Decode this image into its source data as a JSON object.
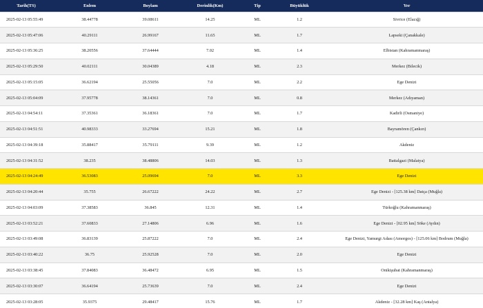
{
  "table": {
    "headers": {
      "date": "Tarih(TS)",
      "lat": "Enlem",
      "lon": "Boylam",
      "depth": "Derinlik(Km)",
      "type": "Tip",
      "magnitude": "Büyüklük",
      "location": "Yer"
    },
    "highlight_color": "#ffe400",
    "header_color": "#152b5c",
    "rows": [
      {
        "date": "2025-02-13 05:55:49",
        "lat": "38.44778",
        "lon": "39.08611",
        "depth": "14.25",
        "type": "ML",
        "magnitude": "1.2",
        "location": "Sivrice (Elazığ)"
      },
      {
        "date": "2025-02-13 05:47:06",
        "lat": "40.29111",
        "lon": "26.99167",
        "depth": "11.65",
        "type": "ML",
        "magnitude": "1.7",
        "location": "Lapseki (Çanakkale)"
      },
      {
        "date": "2025-02-13 05:36:25",
        "lat": "38.20556",
        "lon": "37.64444",
        "depth": "7.02",
        "type": "ML",
        "magnitude": "1.4",
        "location": "Elbistan (Kahramanmaraş)"
      },
      {
        "date": "2025-02-13 05:29:50",
        "lat": "40.02111",
        "lon": "30.04389",
        "depth": "4.18",
        "type": "ML",
        "magnitude": "2.3",
        "location": "Merkez (Bilecik)"
      },
      {
        "date": "2025-02-13 05:15:05",
        "lat": "36.62194",
        "lon": "25.55056",
        "depth": "7.0",
        "type": "ML",
        "magnitude": "2.2",
        "location": "Ege Denizi"
      },
      {
        "date": "2025-02-13 05:04:09",
        "lat": "37.95778",
        "lon": "38.14361",
        "depth": "7.0",
        "type": "ML",
        "magnitude": "0.8",
        "location": "Merkez (Adıyaman)"
      },
      {
        "date": "2025-02-13 04:54:11",
        "lat": "37.35361",
        "lon": "36.18361",
        "depth": "7.0",
        "type": "ML",
        "magnitude": "1.7",
        "location": "Kadirli (Osmaniye)"
      },
      {
        "date": "2025-02-13 04:51:51",
        "lat": "40.98333",
        "lon": "33.27694",
        "depth": "15.21",
        "type": "ML",
        "magnitude": "1.8",
        "location": "Bayramören (Çankırı)"
      },
      {
        "date": "2025-02-13 04:39:18",
        "lat": "35.88417",
        "lon": "35.79111",
        "depth": "9.39",
        "type": "ML",
        "magnitude": "1.2",
        "location": "Akdeniz"
      },
      {
        "date": "2025-02-13 04:31:52",
        "lat": "38.235",
        "lon": "38.48806",
        "depth": "14.03",
        "type": "ML",
        "magnitude": "1.3",
        "location": "Battalgazi (Malatya)"
      },
      {
        "date": "2025-02-13 04:24:49",
        "lat": "36.53083",
        "lon": "25.09694",
        "depth": "7.0",
        "type": "ML",
        "magnitude": "3.3",
        "location": "Ege Denizi",
        "highlight": true
      },
      {
        "date": "2025-02-13 04:20:44",
        "lat": "35.755",
        "lon": "26.67222",
        "depth": "24.22",
        "type": "ML",
        "magnitude": "2.7",
        "location": "Ege Denizi - [125.38 km] Datça (Muğla)"
      },
      {
        "date": "2025-02-13 04:03:09",
        "lat": "37.38583",
        "lon": "36.845",
        "depth": "12.31",
        "type": "ML",
        "magnitude": "1.4",
        "location": "Türkoğlu (Kahramanmaraş)"
      },
      {
        "date": "2025-02-13 03:52:21",
        "lat": "37.60833",
        "lon": "27.14806",
        "depth": "6.96",
        "type": "ML",
        "magnitude": "1.6",
        "location": "Ege Denizi - [02.95 km] Söke (Aydın)"
      },
      {
        "date": "2025-02-13 03:49:08",
        "lat": "36.83139",
        "lon": "25.87222",
        "depth": "7.0",
        "type": "ML",
        "magnitude": "2.4",
        "location": "Ege Denizi, Yamurgi Adası (Amorgos) - [125.06 km] Bodrum (Muğla)"
      },
      {
        "date": "2025-02-13 03:40:22",
        "lat": "36.75",
        "lon": "25.92528",
        "depth": "7.0",
        "type": "ML",
        "magnitude": "2.0",
        "location": "Ege Denizi"
      },
      {
        "date": "2025-02-13 03:38:45",
        "lat": "37.84083",
        "lon": "36.48472",
        "depth": "6.95",
        "type": "ML",
        "magnitude": "1.5",
        "location": "Onikişubat (Kahramanmaraş)"
      },
      {
        "date": "2025-02-13 03:30:07",
        "lat": "36.64194",
        "lon": "25.73639",
        "depth": "7.0",
        "type": "ML",
        "magnitude": "2.4",
        "location": "Ege Denizi"
      },
      {
        "date": "2025-02-13 03:28:05",
        "lat": "35.9375",
        "lon": "29.48417",
        "depth": "15.76",
        "type": "ML",
        "magnitude": "1.7",
        "location": "Akdeniz - [32.28 km] Kaş (Antalya)"
      }
    ]
  }
}
